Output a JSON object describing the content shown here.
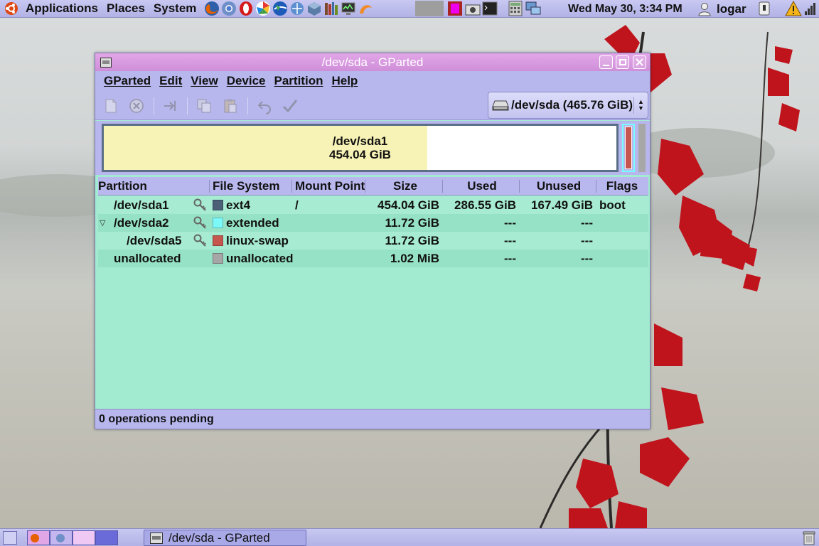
{
  "top_panel": {
    "menus": [
      "Applications",
      "Places",
      "System"
    ],
    "launchers": [
      "firefox-icon",
      "chromium-icon",
      "opera-icon",
      "picasa-icon",
      "google-earth-icon",
      "network-icon",
      "virtualbox-icon",
      "library-icon",
      "system-monitor-icon",
      "banshee-icon"
    ],
    "clock": "Wed May 30,  3:34 PM",
    "user": "logar"
  },
  "window": {
    "title": "/dev/sda - GParted",
    "menubar": [
      "GParted",
      "Edit",
      "View",
      "Device",
      "Partition",
      "Help"
    ],
    "device_selector": "/dev/sda  (465.76 GiB)",
    "disk_visual": {
      "partition_name": "/dev/sda1",
      "partition_size": "454.04 GiB",
      "used_fraction": 0.631
    },
    "table": {
      "columns": [
        "Partition",
        "File System",
        "Mount Point",
        "Size",
        "Used",
        "Unused",
        "Flags"
      ],
      "rows": [
        {
          "partition": "/dev/sda1",
          "fs": "ext4",
          "fs_color": "#4b6076",
          "mount": "/",
          "size": "454.04 GiB",
          "used": "286.55 GiB",
          "unused": "167.49 GiB",
          "flags": "boot"
        },
        {
          "partition": "/dev/sda2",
          "fs": "extended",
          "fs_color": "#7cf8f8",
          "mount": "",
          "size": "11.72 GiB",
          "used": "---",
          "unused": "---",
          "flags": ""
        },
        {
          "partition": "/dev/sda5",
          "fs": "linux-swap",
          "fs_color": "#c5574f",
          "mount": "",
          "size": "11.72 GiB",
          "used": "---",
          "unused": "---",
          "flags": ""
        },
        {
          "partition": "unallocated",
          "fs": "unallocated",
          "fs_color": "#a6a6a6",
          "mount": "",
          "size": "1.02 MiB",
          "used": "---",
          "unused": "---",
          "flags": ""
        }
      ]
    },
    "status": "0 operations pending"
  },
  "bottom_panel": {
    "task": "/dev/sda - GParted"
  }
}
